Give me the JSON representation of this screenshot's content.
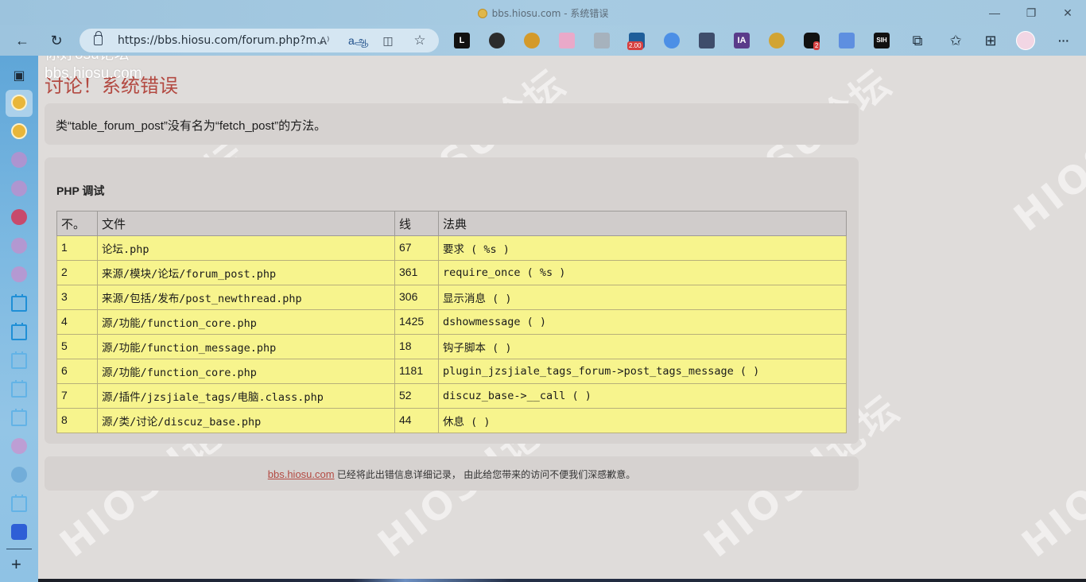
{
  "window": {
    "title": "bbs.hiosu.com - 系统错误",
    "minimize_glyph": "—",
    "restore_glyph": "❐",
    "close_glyph": "✕"
  },
  "toolbar": {
    "back_glyph": "←",
    "refresh_glyph": "↻",
    "url": "https://bbs.hiosu.com/forum.php?m...",
    "read_aloud_label": "A⁾",
    "translate_label": "aஆ",
    "split_label": "◫",
    "favorite_label": "☆",
    "extensions": [
      {
        "name": "L",
        "color": "#111111"
      },
      {
        "name": "ghost",
        "color": "#2c2c2c"
      },
      {
        "name": "dog",
        "color": "#d49a2a"
      },
      {
        "name": "calendar",
        "color": "#e38fb8"
      },
      {
        "name": "clipboard",
        "color": "#8a97a3"
      },
      {
        "name": "speed",
        "color": "#1f5e9a",
        "badge": "2.00"
      },
      {
        "name": "search",
        "color": "#4c8fe6"
      },
      {
        "name": "apps",
        "color": "#3f4d6b"
      },
      {
        "name": "IA",
        "color": "#5a3b8a"
      },
      {
        "name": "pikachu",
        "color": "#d2a433"
      },
      {
        "name": "notify",
        "color": "#111111",
        "badge": "2"
      },
      {
        "name": "frame",
        "color": "#5e8fe0"
      },
      {
        "name": "SIH",
        "color": "#111111"
      }
    ],
    "puzzle_glyph": "⧉",
    "favorites_glyph": "✩",
    "collections_glyph": "⊞",
    "menu_glyph": "···"
  },
  "overlay": {
    "line1": "你好osu论坛",
    "line2": "bbs.hiosu.com"
  },
  "page": {
    "error_title": "讨论！系统错误",
    "error_message": "类“table_forum_post”没有名为“fetch_post”的方法。",
    "debug_heading": "PHP 调试",
    "table": {
      "headers": [
        "不。",
        "文件",
        "线",
        "法典"
      ],
      "rows": [
        {
          "no": "1",
          "file": "论坛.php",
          "line": "67",
          "code": "要求 ( %s )"
        },
        {
          "no": "2",
          "file": "来源/模块/论坛/forum_post.php",
          "line": "361",
          "code": "require_once ( %s )"
        },
        {
          "no": "3",
          "file": "来源/包括/发布/post_newthread.php",
          "line": "306",
          "code": "显示消息 ( )"
        },
        {
          "no": "4",
          "file": "源/功能/function_core.php",
          "line": "1425",
          "code": "dshowmessage ( )"
        },
        {
          "no": "5",
          "file": "源/功能/function_message.php",
          "line": "18",
          "code": "钩子脚本 ( )"
        },
        {
          "no": "6",
          "file": "源/功能/function_core.php",
          "line": "1181",
          "code": "plugin_jzsjiale_tags_forum->post_tags_message ( )"
        },
        {
          "no": "7",
          "file": "源/插件/jzsjiale_tags/电脑.class.php",
          "line": "52",
          "code": "discuz_base->__call ( )"
        },
        {
          "no": "8",
          "file": "源/类/讨论/discuz_base.php",
          "line": "44",
          "code": "休息 ( )"
        }
      ]
    },
    "footer_link": "bbs.hiosu.com",
    "footer_text": " 已经将此出错信息详细记录， 由此给您带来的访问不便我们深感歉意。",
    "watermark_text": "HIOSU论坛"
  },
  "colors": {
    "error_red": "#b34a42",
    "row_yellow": "#f7f48d",
    "page_bg": "#dfdcda"
  }
}
